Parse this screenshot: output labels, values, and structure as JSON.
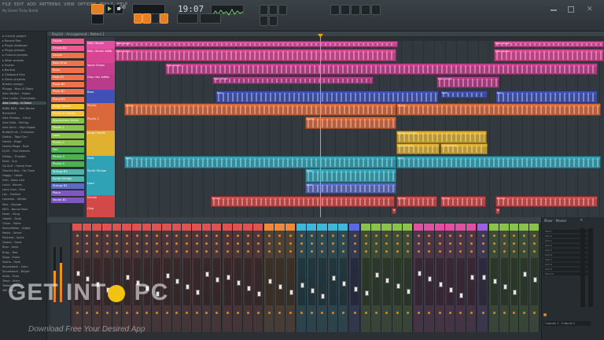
{
  "app": {
    "title": "FL Studio",
    "window_title": "My Dazed Tricky Bomb"
  },
  "menu": [
    "FILE",
    "EDIT",
    "ADD",
    "PATTERNS",
    "VIEW",
    "OPTIONS",
    "TOOLS",
    "HELP"
  ],
  "transport": {
    "song_position": "19:07",
    "counter": "00",
    "pattern": "Pattern 1"
  },
  "playlist": {
    "title": "Playlist - Arrangement › Pattern 1"
  },
  "browser": {
    "items": [
      "Current project",
      "Recent files",
      "Plugin database",
      "Plugin presets",
      "Channel presets",
      "Mixer presets",
      "Scores",
      "Backup",
      "Clipboard files",
      "Demo projects",
      "Breaks (songs)",
      "Pluggy - Keys & Steps",
      "Alan Walker - Faded",
      "Alex Lustig - Everybody",
      "Alex Lustig - Is Dead",
      "BRBK BKS - Red Bimbe",
      "Brickyard",
      "Alex Preston - Grind",
      "Alex Feila - Talking",
      "Alex Kuhn - High Hopes",
      "BuddyFunk - Funkylow",
      "Daddy - Tape Corr",
      "Danka - Rage",
      "Danko Mega - Rust",
      "DJ Eli - Tisk Dreams",
      "Distop - Thunder",
      "Ekali - Sun",
      "Go Surf - Hands Free",
      "Gaucho Boy - Up Close",
      "Haggy - Haste",
      "Irish - Bass Line",
      "Lucid - Moves",
      "Lane Cool - Free",
      "Lev - Fanfare",
      "Loveless - Winter",
      "Max - Voyage",
      "MD1 - Bonus Pack",
      "Noah - Song",
      "Objekt - Dusk",
      "Oliver - Bend",
      "PeaceMaker - Alight",
      "Pedro - Seven",
      "Polarsat - Spice",
      "Queen - Sand",
      "Rian - Hold",
      "Ruby - Red",
      "Saga - Pulse",
      "Sasha - Heat",
      "Soundwork - Calm",
      "Soundwork - Bright",
      "Sudo - Echo",
      "Tame - Stars",
      "Tebbit - Fold",
      "Veil - Rise",
      "Wave - Lift",
      "Yesha - Go",
      "Zion - Drift",
      "Zola - Glow"
    ]
  },
  "patterns": [
    {
      "name": "Drums",
      "color": "#e85a8e"
    },
    {
      "name": "Drums B2",
      "color": "#e85a8e"
    },
    {
      "name": "Drums",
      "color": "#f0724d"
    },
    {
      "name": "Bass Drop",
      "color": "#f0724d"
    },
    {
      "name": "Kicks",
      "color": "#f0724d"
    },
    {
      "name": "Pads B1",
      "color": "#f0724d"
    },
    {
      "name": "Pluck B2",
      "color": "#f0724d"
    },
    {
      "name": "Pluck B1",
      "color": "#f0724d"
    },
    {
      "name": "Piano B3",
      "color": "#f0724d"
    },
    {
      "name": "Jump Chords",
      "color": "#f1c232"
    },
    {
      "name": "Plucks & Chords",
      "color": "#f1c232"
    },
    {
      "name": "Atmosphere Noise",
      "color": "#8bc34a"
    },
    {
      "name": "Plucks 1",
      "color": "#8bc34a"
    },
    {
      "name": "Lead",
      "color": "#8bc34a"
    },
    {
      "name": "Plucks 2",
      "color": "#8bc34a"
    },
    {
      "name": "Pad",
      "color": "#4caf50"
    },
    {
      "name": "Plucks 3",
      "color": "#4caf50"
    },
    {
      "name": "Plucks 4",
      "color": "#4caf50"
    },
    {
      "name": "Strings B3",
      "color": "#4db6ac"
    },
    {
      "name": "Synth Strings",
      "color": "#4db6ac"
    },
    {
      "name": "Strings B2",
      "color": "#5c6bc0"
    },
    {
      "name": "Piano",
      "color": "#7e57c2"
    },
    {
      "name": "Vocals B1",
      "color": "#7e57c2"
    }
  ],
  "tracks": [
    {
      "name": "Main Vocals",
      "color": "#e04fa0"
    },
    {
      "name": "Main Vocals Adlib",
      "color": "#d94593"
    },
    {
      "name": "Vocal Chops",
      "color": "#c83e8f"
    },
    {
      "name": "Drop Vox Adlibs",
      "color": "#b93b8a"
    },
    {
      "name": "Bass",
      "color": "#3f51b5"
    },
    {
      "name": "Plucks",
      "color": "#d9683a"
    },
    {
      "name": "Plucks 2",
      "color": "#d9683a"
    },
    {
      "name": "Jump Chords",
      "color": "#e0b030"
    },
    {
      "name": "Pads",
      "color": "#2fa3b5"
    },
    {
      "name": "Synth Strings",
      "color": "#2fa3b5"
    },
    {
      "name": "Lead",
      "color": "#2fa3b5"
    },
    {
      "name": "Drums",
      "color": "#d34848"
    },
    {
      "name": "Clap",
      "color": "#d34848"
    }
  ],
  "clip_labels": {
    "vocals": "Main Vocals",
    "bass": "Bass",
    "plucks": "Plucks",
    "chords": "Plucks & Chords",
    "jump": "Jump Chords",
    "pads": "Pads",
    "drums": "Drums"
  },
  "mixer": {
    "title": "Mixer - Master",
    "insert_slots": [
      "Slot 1",
      "Slot 2",
      "Slot 3",
      "Slot 4",
      "Slot 5",
      "Slot 6",
      "Slot 7",
      "Slot 8",
      "Slot 9",
      "Slot 10"
    ],
    "output": "Outputs 1 - Outputs 2",
    "groups": [
      {
        "color": "#e05252",
        "width": 190
      },
      {
        "color": "#e05252",
        "width": 52
      },
      {
        "color": "#f08a3a",
        "width": 40
      },
      {
        "color": "#3fb8d8",
        "width": 66
      },
      {
        "color": "#5b6ae0",
        "width": 14
      },
      {
        "color": "#8bc34a",
        "width": 66
      },
      {
        "color": "#e04fa0",
        "width": 80
      },
      {
        "color": "#9c5fe0",
        "width": 14
      },
      {
        "color": "#8bc34a",
        "width": 64
      }
    ]
  },
  "watermark": {
    "title_left": "GET INT",
    "title_right": " PC",
    "subtitle": "Download Free Your Desired App"
  }
}
